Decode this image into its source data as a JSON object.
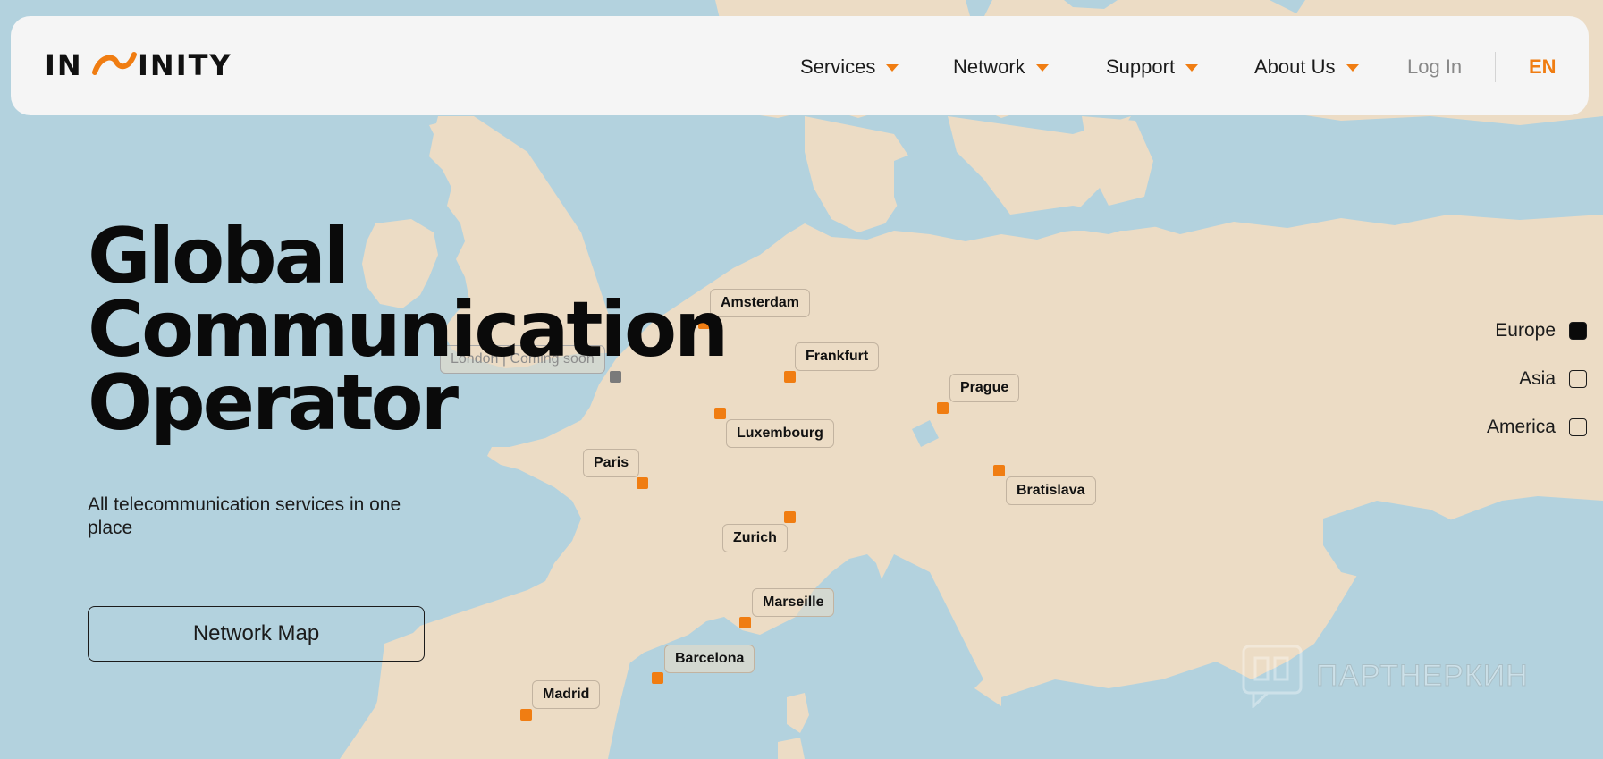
{
  "header": {
    "nav": [
      {
        "label": "Services"
      },
      {
        "label": "Network"
      },
      {
        "label": "Support"
      },
      {
        "label": "About Us"
      }
    ],
    "login_label": "Log In",
    "language": "EN"
  },
  "brand": {
    "logo_text": "INFINITY",
    "accent": "#f07d12"
  },
  "hero": {
    "title_lines": [
      "Global",
      "Communication",
      "Operator"
    ],
    "subtitle": "All telecommunication services in one place",
    "cta_label": "Network Map"
  },
  "cities": [
    {
      "name": "Amsterdam"
    },
    {
      "name": "London | Coming soon"
    },
    {
      "name": "Frankfurt"
    },
    {
      "name": "Prague"
    },
    {
      "name": "Luxembourg"
    },
    {
      "name": "Paris"
    },
    {
      "name": "Bratislava"
    },
    {
      "name": "Zurich"
    },
    {
      "name": "Marseille"
    },
    {
      "name": "Barcelona"
    },
    {
      "name": "Madrid"
    }
  ],
  "regions": [
    {
      "label": "Europe",
      "checked": true
    },
    {
      "label": "Asia",
      "checked": false
    },
    {
      "label": "America",
      "checked": false
    }
  ],
  "watermark": "ПАРТНЕРКИН",
  "colors": {
    "land": "#ecdcc5",
    "water": "#b3d2de",
    "marker": "#f07d12",
    "header_bg": "#f5f5f5"
  }
}
